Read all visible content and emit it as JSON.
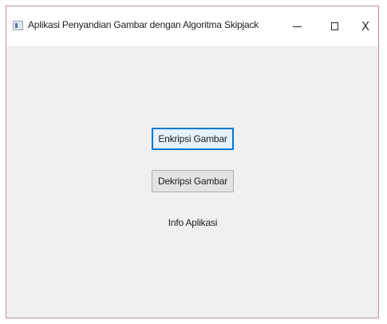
{
  "window": {
    "title": "Aplikasi Penyandian Gambar dengan Algoritma Skipjack",
    "close_glyph": "X"
  },
  "main": {
    "encrypt_button": "Enkripsi Gambar",
    "decrypt_button": "Dekripsi Gambar",
    "info_link": "Info Aplikasi"
  },
  "colors": {
    "focus_border": "#0078d7",
    "window_background": "#f0f0f0"
  }
}
